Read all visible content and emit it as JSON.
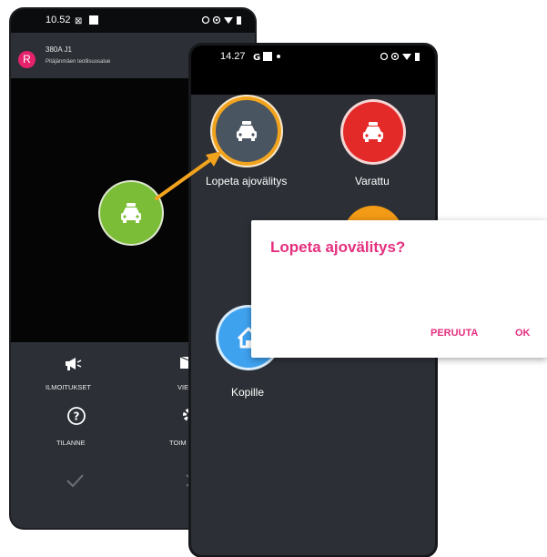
{
  "back_phone": {
    "status_time": "10.52",
    "header": {
      "avatar_letter": "R",
      "route": "380A J1",
      "area": "Pitäjänmäen teollisuusalue"
    },
    "bottom_menu": {
      "ilmoitukset": "ILMOITUKSET",
      "vie_partial": "VIE",
      "tilanne": "TILANNE",
      "toim_partial": "TOIM"
    }
  },
  "front_phone": {
    "status_time": "14.27",
    "buttons": {
      "lopeta": "Lopeta ajovälitys",
      "varattu": "Varattu",
      "kopille": "Kopille"
    }
  },
  "dialog": {
    "title": "Lopeta ajovälitys?",
    "cancel_label": "PERUUTA",
    "ok_label": "OK"
  },
  "colors": {
    "accent_pink": "#e4307f",
    "taxi_green": "#7cbd37",
    "busy_red": "#e42a28",
    "highlight_orange": "#f2a31e",
    "home_blue": "#3fa2ef"
  }
}
